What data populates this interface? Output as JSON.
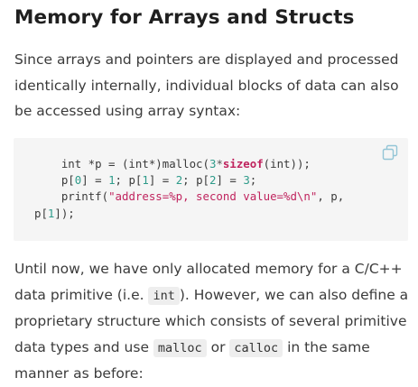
{
  "article": {
    "title": "Memory for Arrays and Structs",
    "para1": "Since arrays and pointers are displayed and processed identically internally, individual blocks of data can also be accessed using array syntax:",
    "code": {
      "l1_a": "    int *p = (int*)malloc(",
      "l1_num": "3",
      "l1_star": "*",
      "l1_kw": "sizeof",
      "l1_b": "(int));",
      "l2_a": "    p[",
      "l2_n0": "0",
      "l2_b": "] = ",
      "l2_n1": "1",
      "l2_c": "; p[",
      "l2_n2": "1",
      "l2_d": "] = ",
      "l2_n3": "2",
      "l2_e": "; p[",
      "l2_n4": "2",
      "l2_f": "] = ",
      "l2_n5": "3",
      "l2_g": ";",
      "l3_a": "    printf(",
      "l3_str": "\"address=%p, second value=%d\\n\"",
      "l3_b": ", p,",
      "l4_a": "p[",
      "l4_n": "1",
      "l4_b": "]);"
    },
    "para2": {
      "t1": "Until now, we have only allocated memory for a C/C++ data primitive (i.e. ",
      "code1": "int",
      "t2": "). However, we can also define a proprietary structure which consists of several primitive data types and use ",
      "code2": "malloc",
      "t3": " or ",
      "code3": "calloc",
      "t4": " in the same manner as before:"
    }
  },
  "icons": {
    "copy": "copy-icon"
  },
  "colors": {
    "keyword": "#c0245e",
    "number": "#2e9b8a",
    "string": "#c0245e",
    "code_bg": "#f5f5f5",
    "inline_code_bg": "#eeeeee",
    "copy_icon": "#93c5d6"
  }
}
